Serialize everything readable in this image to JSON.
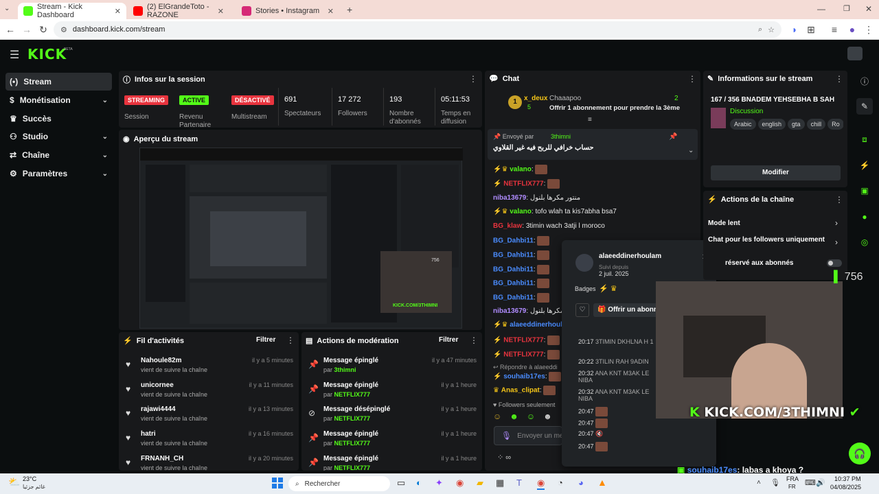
{
  "browser": {
    "tabs": [
      {
        "title": "Stream - Kick Dashboard",
        "icon": "kick-icon",
        "color": "#53fc18"
      },
      {
        "title": "(2) ElGrandeToto - RAZONE",
        "icon": "youtube-icon",
        "color": "#ff0000"
      },
      {
        "title": "Stories • Instagram",
        "icon": "instagram-icon",
        "color": "#d62976"
      }
    ],
    "url": "dashboard.kick.com/stream"
  },
  "brand": {
    "logo": "KICK",
    "beta": "BETA"
  },
  "sidebar": {
    "items": [
      {
        "label": "Stream",
        "icon": "stream-icon",
        "active": true
      },
      {
        "label": "Monétisation",
        "icon": "dollar-icon"
      },
      {
        "label": "Succès",
        "icon": "trophy-icon"
      },
      {
        "label": "Studio",
        "icon": "studio-icon"
      },
      {
        "label": "Chaîne",
        "icon": "channel-icon"
      },
      {
        "label": "Paramètres",
        "icon": "gear-icon"
      }
    ]
  },
  "session": {
    "title": "Infos sur la session",
    "badges": [
      {
        "badge": "STREAMING",
        "label": "Session",
        "color": "#e8343e"
      },
      {
        "badge": "ACTIVE",
        "label": "Revenu Partenaire",
        "color": "#53fc18"
      },
      {
        "badge": "DÉSACTIVÉ",
        "label": "Multistream",
        "color": "#e8343e"
      }
    ],
    "stats": [
      {
        "value": "691",
        "label": "Spectateurs"
      },
      {
        "value": "17 272",
        "label": "Followers"
      },
      {
        "value": "193",
        "label": "Nombre d'abonnés"
      },
      {
        "value": "05:11:53",
        "label": "Temps en diffusion"
      }
    ]
  },
  "preview": {
    "title": "Aperçu du stream"
  },
  "activity": {
    "title": "Fil d'activités",
    "filter": "Filtrer",
    "items": [
      {
        "name": "Nahoule82m",
        "sub": "vient de suivre la chaîne",
        "time": "il y a 5 minutes"
      },
      {
        "name": "unicornee",
        "sub": "vient de suivre la chaîne",
        "time": "il y a 11 minutes"
      },
      {
        "name": "rajawi4444",
        "sub": "vient de suivre la chaîne",
        "time": "il y a 13 minutes"
      },
      {
        "name": "hatri",
        "sub": "vient de suivre la chaîne",
        "time": "il y a 16 minutes"
      },
      {
        "name": "FRNANH_CH",
        "sub": "vient de suivre la chaîne",
        "time": "il y a 20 minutes"
      }
    ]
  },
  "moderation": {
    "title": "Actions de modération",
    "filter": "Filtrer",
    "items": [
      {
        "action": "Message épinglé",
        "by": "par",
        "user": "3thimni",
        "time": "il y a 47 minutes"
      },
      {
        "action": "Message épinglé",
        "by": "par",
        "user": "NETFLIX777",
        "time": "il y a 1 heure"
      },
      {
        "action": "Message désépinglé",
        "by": "par",
        "user": "NETFLIX777",
        "time": "il y a 1 heure"
      },
      {
        "action": "Message épinglé",
        "by": "par",
        "user": "NETFLIX777",
        "time": "il y a 1 heure"
      },
      {
        "action": "Message épinglé",
        "by": "par",
        "user": "NETFLIX777",
        "time": "il y a 1 heure"
      }
    ]
  },
  "chat": {
    "title": "Chat",
    "leader": {
      "rank": "1",
      "user": "x_deux",
      "count": "5",
      "gifter": "Chaaapoo",
      "gift_count": "2",
      "gift_text": "Offrir 1 abonnement pour prendre la 3ème"
    },
    "pinned": {
      "label": "Envoyé par",
      "user": "3thimni",
      "text": "حساب خرافي للربح فيه غير القلاوي"
    },
    "messages": [
      {
        "user": "valano",
        "text": "",
        "color": "#53fc18",
        "emote": true
      },
      {
        "user": "NETFLIX777",
        "text": "",
        "color": "#e8343e",
        "emote": true
      },
      {
        "user": "niba13679",
        "text": "منتور مكرها بلنول",
        "color": "#b08cff"
      },
      {
        "user": "valano",
        "text": "tofo wlah ta kis7abha bsa7",
        "color": "#53fc18"
      },
      {
        "user": "BG_klaw",
        "text": "3timin wach 3atji l moroco",
        "color": "#e8343e"
      },
      {
        "user": "BG_Dahbi11",
        "text": "",
        "color": "#4a8cff",
        "emote": true
      },
      {
        "user": "BG_Dahbi11",
        "text": "",
        "color": "#4a8cff",
        "emote": true
      },
      {
        "user": "BG_Dahbi11",
        "text": "",
        "color": "#4a8cff",
        "emote": true
      },
      {
        "user": "BG_Dahbi11",
        "text": "",
        "color": "#4a8cff",
        "emote": true
      },
      {
        "user": "BG_Dahbi11",
        "text": "",
        "color": "#4a8cff",
        "emote": true
      },
      {
        "user": "niba13679",
        "text": "منتور مكرها بلنول",
        "color": "#b08cff"
      },
      {
        "user": "alaeeddinerhoul",
        "text": "",
        "color": "#4a8cff"
      },
      {
        "user": "NETFLIX777",
        "text": "",
        "color": "#e8343e",
        "emote": true
      },
      {
        "user": "NETFLIX777",
        "text": "",
        "color": "#e8343e",
        "emote": true
      }
    ],
    "reply_to": "Répondre à alaeeddi",
    "reply_msgs": [
      {
        "user": "souhaib17es",
        "text": "",
        "color": "#4a8cff",
        "emote": true
      },
      {
        "user": "Anas_clipat",
        "text": "",
        "color": "#f5c518",
        "emote": true
      }
    ],
    "followers_only": "Followers seulement",
    "input_placeholder": "Envoyer un me"
  },
  "user_card": {
    "username": "alaeeddinerhoulam",
    "followed_label": "Suivi depuis",
    "followed_date": "2 juil. 2025",
    "badges_label": "Badges",
    "gift_btn": "Offrir un abonn",
    "history": [
      {
        "time": "20:17",
        "text": "3TIMIN DKHLNA H 1"
      },
      {
        "time": "20:22",
        "text": "3TILIN RAH 9ADIN"
      },
      {
        "time": "20:32",
        "text": "ANA KNT M3AK LE NIBA"
      },
      {
        "time": "20:32",
        "text": "ANA KNT M3AK LE NIBA"
      },
      {
        "time": "20:47",
        "text": ""
      },
      {
        "time": "20:47",
        "text": ""
      },
      {
        "time": "20:47",
        "text": ""
      },
      {
        "time": "20:47",
        "text": ""
      }
    ]
  },
  "stream_info": {
    "title": "Informations sur le stream",
    "stream_title": "167 / 356 BNADEM YEHSEBHA B SAH",
    "category": "Discussion",
    "tags": [
      "Arabic",
      "english",
      "gta",
      "chill",
      "Ro"
    ],
    "edit_btn": "Modifier"
  },
  "channel_actions": {
    "title": "Actions de la chaîne",
    "items": [
      {
        "label": "Mode lent"
      },
      {
        "label": "Chat pour les followers uniquement"
      },
      {
        "label": "réservé aux abonnés"
      }
    ]
  },
  "overlay": {
    "viewers": "756",
    "watermark": "KICK.COM/3THIMNI",
    "chat_msg_user": "souhaib17es",
    "chat_msg_text": ": labas a khoya ?"
  },
  "taskbar": {
    "weather_temp": "23°C",
    "weather_desc": "غائم جزئيا",
    "search": "Rechercher",
    "lang": "FRA",
    "lang2": "FR",
    "time": "10:37 PM",
    "date": "04/08/2025"
  }
}
